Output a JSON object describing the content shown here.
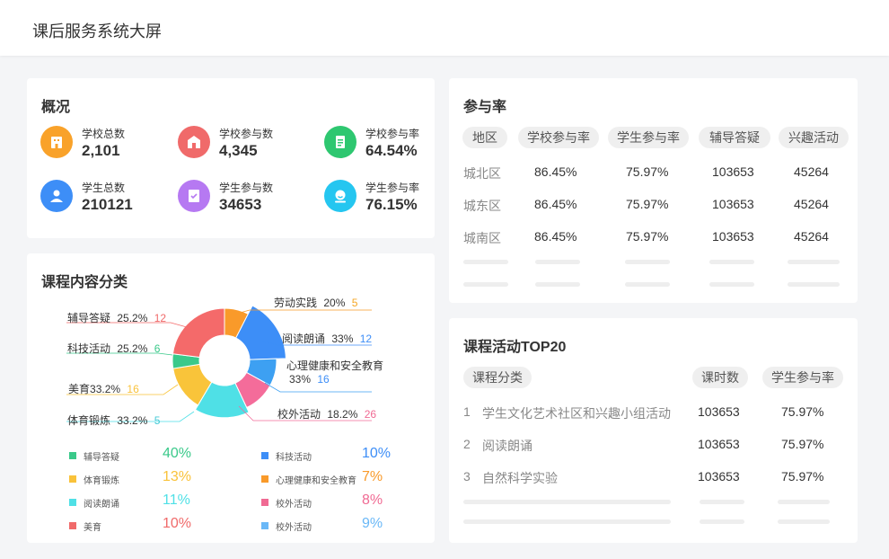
{
  "header": {
    "title": "课后服务系统大屏"
  },
  "overview": {
    "title": "概况",
    "stats": [
      {
        "label": "学校总数",
        "value": "2,101",
        "icon": "building-icon",
        "color": "#f9a22a"
      },
      {
        "label": "学校参与数",
        "value": "4,345",
        "icon": "school-icon",
        "color": "#f06a6a"
      },
      {
        "label": "学校参与率",
        "value": "64.54%",
        "icon": "document-icon",
        "color": "#2ec770"
      },
      {
        "label": "学生总数",
        "value": "210121",
        "icon": "student-icon",
        "color": "#3d8ef7"
      },
      {
        "label": "学生参与数",
        "value": "34653",
        "icon": "checklist-icon",
        "color": "#b679f2"
      },
      {
        "label": "学生参与率",
        "value": "76.15%",
        "icon": "face-icon",
        "color": "#25c6f0"
      }
    ]
  },
  "course": {
    "title": "课程内容分类",
    "slices": [
      {
        "name": "劳动实践",
        "pct": "20%",
        "num": "5",
        "numColor": "#f5a623"
      },
      {
        "name": "阅读朗诵",
        "pct": "33%",
        "num": "12",
        "numColor": "#3d8ef7"
      },
      {
        "name": "心理健康和安全教育",
        "pct": "33%",
        "num": "16",
        "numColor": "#3d8ef7"
      },
      {
        "name": "校外活动",
        "pct": "18.2%",
        "num": "26",
        "numColor": "#f06a93"
      },
      {
        "name": "体育锻炼",
        "pct": "33.2%",
        "num": "5",
        "numColor": "#44c9d6"
      },
      {
        "name": "美育",
        "pct": "33.2%",
        "num": "16",
        "numColor": "#f9c23a"
      },
      {
        "name": "科技活动",
        "pct": "25.2%",
        "num": "6",
        "numColor": "#3ac98a"
      },
      {
        "name": "辅导答疑",
        "pct": "25.2%",
        "num": "12",
        "numColor": "#f06a6a"
      }
    ],
    "donut": [
      {
        "color": "#f99a2a",
        "share": 0.075
      },
      {
        "color": "#3d8ef7",
        "share": 0.17
      },
      {
        "color": "#3da0f2",
        "share": 0.085
      },
      {
        "color": "#f46c9a",
        "share": 0.1
      },
      {
        "color": "#4fe0e6",
        "share": 0.155
      },
      {
        "color": "#f9c43a",
        "share": 0.14
      },
      {
        "color": "#3ac98a",
        "share": 0.045
      },
      {
        "color": "#f46a6a",
        "share": 0.23
      }
    ],
    "legend": [
      {
        "label": "辅导答疑",
        "pct": "40%",
        "color": "#3ac98a"
      },
      {
        "label": "科技活动",
        "pct": "10%",
        "color": "#3d8ef7"
      },
      {
        "label": "体育锻炼",
        "pct": "13%",
        "color": "#f9c23a"
      },
      {
        "label": "心理健康和安全教育",
        "pct": "7%",
        "color": "#f99a2a"
      },
      {
        "label": "阅读朗诵",
        "pct": "11%",
        "color": "#4fe0e6"
      },
      {
        "label": "校外活动",
        "pct": "8%",
        "color": "#f06a93"
      },
      {
        "label": "美育",
        "pct": "10%",
        "color": "#f06a6a"
      },
      {
        "label": "校外活动",
        "pct": "9%",
        "color": "#6ab8f7"
      }
    ]
  },
  "participation": {
    "title": "参与率",
    "headers": [
      "地区",
      "学校参与率",
      "学生参与率",
      "辅导答疑",
      "兴趣活动"
    ],
    "rows": [
      [
        "城北区",
        "86.45%",
        "75.97%",
        "103653",
        "45264"
      ],
      [
        "城东区",
        "86.45%",
        "75.97%",
        "103653",
        "45264"
      ],
      [
        "城南区",
        "86.45%",
        "75.97%",
        "103653",
        "45264"
      ]
    ]
  },
  "top20": {
    "title": "课程活动TOP20",
    "headers": [
      "课程分类",
      "课时数",
      "学生参与率"
    ],
    "rows": [
      [
        "1",
        "学生文化艺术社区和兴趣小组活动",
        "103653",
        "75.97%"
      ],
      [
        "2",
        "阅读朗诵",
        "103653",
        "75.97%"
      ],
      [
        "3",
        "自然科学实验",
        "103653",
        "75.97%"
      ]
    ]
  }
}
